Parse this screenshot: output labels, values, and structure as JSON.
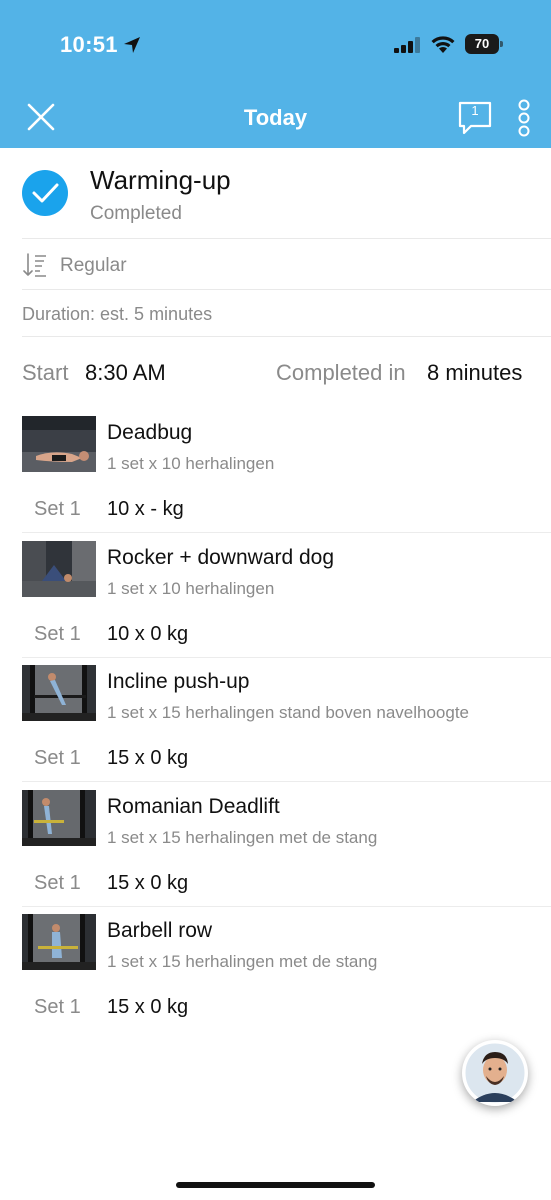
{
  "status_bar": {
    "time": "10:51",
    "battery": "70"
  },
  "nav": {
    "title": "Today",
    "chat_count": "1"
  },
  "workout": {
    "title": "Warming-up",
    "status": "Completed"
  },
  "order": {
    "label": "Regular"
  },
  "duration": "Duration: est. 5 minutes",
  "timing": {
    "start_label": "Start",
    "start_value": "8:30 AM",
    "completed_label": "Completed in",
    "completed_value": "8 minutes"
  },
  "exercises": [
    {
      "name": "Deadbug",
      "description": "1 set x 10 herhalingen",
      "set_label": "Set 1",
      "set_value": "10 x - kg"
    },
    {
      "name": "Rocker + downward dog",
      "description": "1 set x 10 herhalingen",
      "set_label": "Set 1",
      "set_value": "10 x 0 kg"
    },
    {
      "name": "Incline push-up",
      "description": "1 set x 15 herhalingen stand boven navelhoogte",
      "set_label": "Set 1",
      "set_value": "15 x 0 kg"
    },
    {
      "name": "Romanian Deadlift",
      "description": "1 set x 15 herhalingen met de stang",
      "set_label": "Set 1",
      "set_value": "15 x 0 kg"
    },
    {
      "name": "Barbell row",
      "description": "1 set x 15 herhalingen met de stang",
      "set_label": "Set 1",
      "set_value": "15 x 0 kg"
    }
  ],
  "colors": {
    "header": "#53b3e7",
    "check": "#1aa3ec",
    "muted": "#8a8a8a"
  }
}
